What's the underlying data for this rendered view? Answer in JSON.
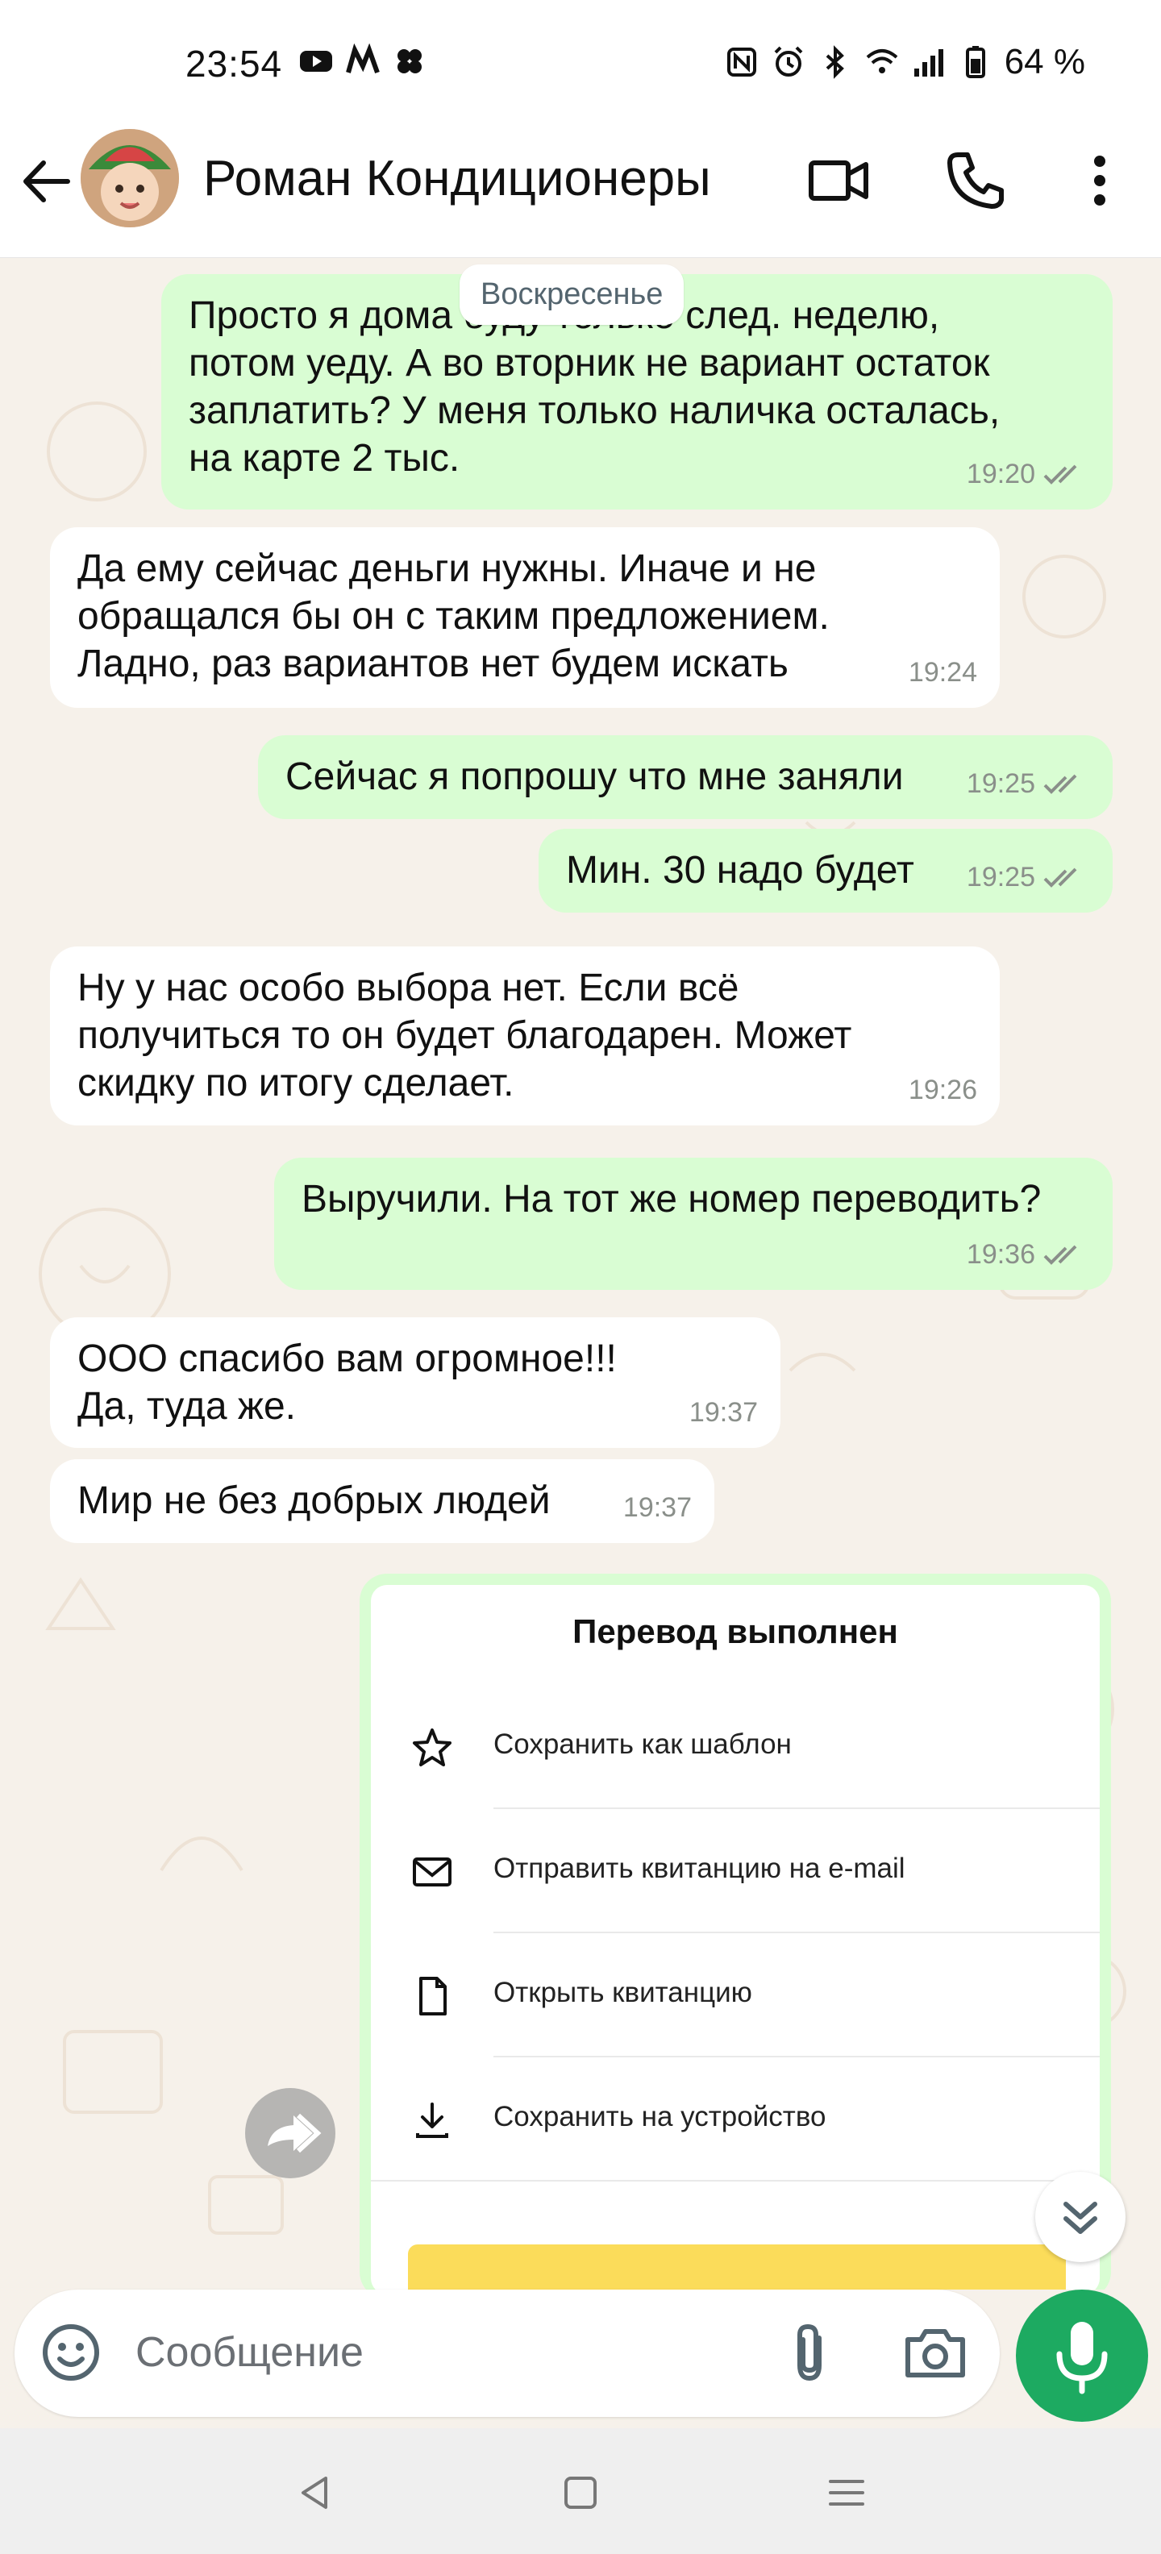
{
  "status": {
    "time": "23:54",
    "battery": "64 %"
  },
  "header": {
    "contact_name": "Роман Кондиционеры"
  },
  "chat": {
    "date_chip": "Воскресенье",
    "messages": [
      {
        "dir": "out",
        "text": "Просто я дома буду только след. неделю,\nпотом уеду. А во вторник не вариант остаток\nзаплатить? У меня только наличка осталась,\nна карте 2 тыс.",
        "time": "19:20"
      },
      {
        "dir": "in",
        "text": "Да ему сейчас деньги нужны. Иначе и не\nобращался бы он с таким предложением.\nЛадно, раз вариантов нет будем искать",
        "time": "19:24"
      },
      {
        "dir": "out",
        "text": "Сейчас я попрошу что мне заняли",
        "time": "19:25"
      },
      {
        "dir": "out",
        "text": "Мин. 30 надо будет",
        "time": "19:25"
      },
      {
        "dir": "in",
        "text": "Ну у нас особо выбора нет. Если всё\nполучиться то он будет благодарен. Может\nскидку по итогу сделает.",
        "time": "19:26"
      },
      {
        "dir": "out",
        "text": "Выручили. На тот же номер переводить?",
        "time": "19:36"
      },
      {
        "dir": "in",
        "text": "ООО спасибо вам огромное!!!\nДа, туда же.",
        "time": "19:37"
      },
      {
        "dir": "in",
        "text": "Мир не без добрых людей",
        "time": "19:37"
      }
    ],
    "card": {
      "title": "Перевод выполнен",
      "items": [
        {
          "icon": "star-icon",
          "label": "Сохранить как шаблон"
        },
        {
          "icon": "mail-icon",
          "label": "Отправить квитанцию на e-mail"
        },
        {
          "icon": "document-icon",
          "label": "Открыть квитанцию"
        },
        {
          "icon": "download-icon",
          "label": "Сохранить на устройство"
        }
      ]
    }
  },
  "composer": {
    "placeholder": "Сообщение"
  },
  "colors": {
    "outgoing_bubble": "#d9fdd3",
    "incoming_bubble": "#ffffff",
    "mic_button": "#1daa61",
    "ticks": "#8a8f8a"
  }
}
